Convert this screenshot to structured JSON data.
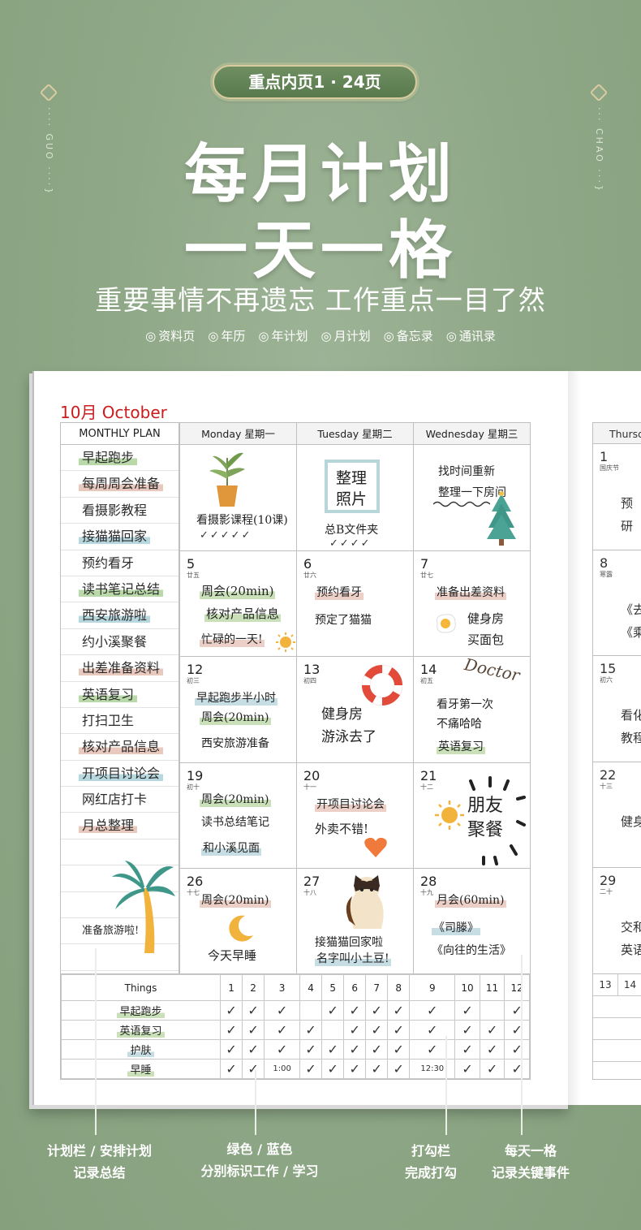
{
  "badge": "重点内页1 · 24页",
  "side_left_text": "···· GUO ····}",
  "side_right_text": "··· CHAO ···}",
  "title_line1": "每月计划",
  "title_line2": "一天一格",
  "subtitle": "重要事情不再遗忘  工作重点一目了然",
  "features": [
    "资料页",
    "年历",
    "年计划",
    "月计划",
    "备忘录",
    "通讯录"
  ],
  "planner": {
    "month_title": "10月 October",
    "plan_header": "MONTHLY PLAN",
    "plan_items": [
      {
        "text": "早起跑步",
        "hl": "green"
      },
      {
        "text": "每周周会准备",
        "hl": "pink"
      },
      {
        "text": "看摄影教程",
        "hl": ""
      },
      {
        "text": "接猫猫回家",
        "hl": "blue"
      },
      {
        "text": "预约看牙",
        "hl": ""
      },
      {
        "text": "读书笔记总结",
        "hl": "green"
      },
      {
        "text": "西安旅游啦",
        "hl": "blue"
      },
      {
        "text": "约小溪聚餐",
        "hl": ""
      },
      {
        "text": "出差准备资料",
        "hl": "pink"
      },
      {
        "text": "英语复习",
        "hl": "green"
      },
      {
        "text": "打扫卫生",
        "hl": ""
      },
      {
        "text": "核对产品信息",
        "hl": "pink"
      },
      {
        "text": "开项目讨论会",
        "hl": "blue"
      },
      {
        "text": "网红店打卡",
        "hl": ""
      },
      {
        "text": "月总整理",
        "hl": "pink"
      },
      {
        "text": "",
        "hl": ""
      },
      {
        "text": "",
        "hl": ""
      },
      {
        "text": "",
        "hl": ""
      },
      {
        "text": "准备旅游啦!",
        "hl": ""
      },
      {
        "text": "",
        "hl": ""
      }
    ],
    "day_headers": [
      "Monday 星期一",
      "Tuesday 星期二",
      "Wednesday 星期三"
    ],
    "week1": {
      "mon": {
        "note": "看摄影课程(10课)",
        "checks": "✓✓✓✓✓"
      },
      "tue": {
        "note1": "整理",
        "note2": "照片",
        "note3": "总B文件夹",
        "checks": "✓✓✓✓"
      },
      "wed": {
        "note1": "找时间重新",
        "note2": "整理一下房间"
      }
    },
    "week2": {
      "mon": {
        "day": "5",
        "lunar": "廿五",
        "n1": "周会(20min)",
        "n2": "核对产品信息",
        "n3": "忙碌的一天!"
      },
      "tue": {
        "day": "6",
        "lunar": "廿六",
        "n1": "预约看牙",
        "n2": "预定了猫猫"
      },
      "wed": {
        "day": "7",
        "lunar": "廿七",
        "n1": "准备出差资料",
        "n2": "健身房",
        "n3": "买面包"
      }
    },
    "week3": {
      "mon": {
        "day": "12",
        "lunar": "初三",
        "n1": "早起跑步半小时",
        "n2": "周会(20min)",
        "n3": "西安旅游准备"
      },
      "tue": {
        "day": "13",
        "lunar": "初四",
        "n1": "健身房",
        "n2": "游泳去了"
      },
      "wed": {
        "day": "14",
        "lunar": "初五",
        "n1": "看牙第一次",
        "n2": "不痛哈哈",
        "n3": "英语复习",
        "sticker": "Doctor"
      }
    },
    "week4": {
      "mon": {
        "day": "19",
        "lunar": "初十",
        "n1": "周会(20min)",
        "n2": "读书总结笔记",
        "n3": "和小溪见面"
      },
      "tue": {
        "day": "20",
        "lunar": "十一",
        "n1": "开项目讨论会",
        "n2": "外卖不错!"
      },
      "wed": {
        "day": "21",
        "lunar": "十二",
        "n1": "朋友",
        "n2": "聚餐"
      }
    },
    "week5": {
      "mon": {
        "day": "26",
        "lunar": "十七",
        "n1": "周会(20min)",
        "n2": "今天早睡"
      },
      "tue": {
        "day": "27",
        "lunar": "十八",
        "n1": "接猫猫回家啦",
        "n2": "名字叫小土豆!"
      },
      "wed": {
        "day": "28",
        "lunar": "十九",
        "n1": "月会(60min)",
        "n2": "《司滕》",
        "n3": "《向往的生活》"
      }
    },
    "things": {
      "header": "Things",
      "days": [
        "1",
        "2",
        "3",
        "4",
        "5",
        "6",
        "7",
        "8",
        "9",
        "10",
        "11",
        "12"
      ],
      "rows": [
        {
          "label": "早起跑步",
          "marks": [
            "✓",
            "✓",
            "✓",
            "",
            "✓",
            "✓",
            "✓",
            "✓",
            "✓",
            "✓",
            "",
            "✓"
          ]
        },
        {
          "label": "英语复习",
          "marks": [
            "✓",
            "✓",
            "✓",
            "✓",
            "",
            "✓",
            "✓",
            "✓",
            "✓",
            "✓",
            "✓",
            "✓"
          ]
        },
        {
          "label": "护肤",
          "marks": [
            "✓",
            "✓",
            "✓",
            "✓",
            "✓",
            "✓",
            "✓",
            "✓",
            "✓",
            "✓",
            "✓",
            "✓"
          ]
        },
        {
          "label": "早睡",
          "marks": [
            "✓",
            "✓",
            "1:00",
            "✓",
            "✓",
            "✓",
            "✓",
            "✓",
            "12:30",
            "✓",
            "✓",
            "✓"
          ]
        }
      ]
    },
    "right_page": {
      "header": "Thursday",
      "cells": [
        {
          "day": "1",
          "lunar": "国庆节",
          "n1": "预",
          "n2": "研"
        },
        {
          "day": "8",
          "lunar": "寒露",
          "n1": "《去",
          "n2": "《乘"
        },
        {
          "day": "15",
          "lunar": "初六",
          "n1": "看化",
          "n2": "教程"
        },
        {
          "day": "22",
          "lunar": "十三",
          "n1": "健身"
        },
        {
          "day": "29",
          "lunar": "二十",
          "n1": "交和",
          "n2": "英语"
        }
      ],
      "things_days": [
        "13",
        "14"
      ]
    }
  },
  "callouts": [
    {
      "line1": "计划栏 / 安排计划",
      "line2": "记录总结"
    },
    {
      "line1": "绿色 / 蓝色",
      "line2": "分别标识工作 / 学习"
    },
    {
      "line1": "打勾栏",
      "line2": "完成打勾"
    },
    {
      "line1": "每天一格",
      "line2": "记录关键事件"
    }
  ]
}
